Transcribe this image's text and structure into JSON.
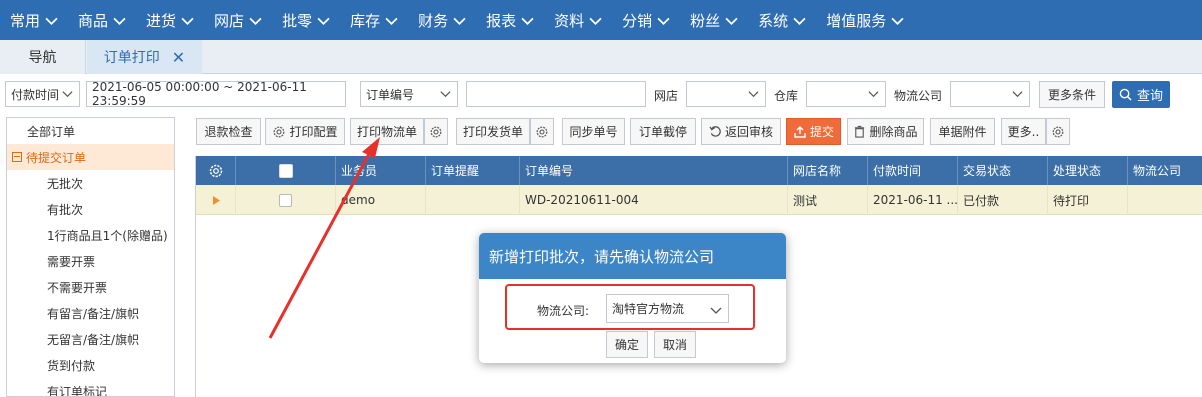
{
  "topnav": {
    "items": [
      {
        "label": "常用"
      },
      {
        "label": "商品"
      },
      {
        "label": "进货"
      },
      {
        "label": "网店"
      },
      {
        "label": "批零"
      },
      {
        "label": "库存"
      },
      {
        "label": "财务"
      },
      {
        "label": "报表"
      },
      {
        "label": "资料"
      },
      {
        "label": "分销"
      },
      {
        "label": "粉丝"
      },
      {
        "label": "系统"
      },
      {
        "label": "增值服务"
      }
    ]
  },
  "tabs": {
    "nav": "导航",
    "order_print": "订单打印",
    "close_glyph": "✕"
  },
  "filters": {
    "time_type": "付款时间",
    "date_range": "2021-06-05 00:00:00 ~ 2021-06-11 23:59:59",
    "order_field": "订单编号",
    "order_value": "",
    "shop_label": "网店",
    "shop_value": "",
    "warehouse_label": "仓库",
    "warehouse_value": "",
    "logistics_label": "物流公司",
    "logistics_value": "",
    "more_conditions": "更多条件",
    "query": "查询"
  },
  "sidebar": {
    "root": "全部订单",
    "group": "待提交订单",
    "children": [
      "无批次",
      "有批次",
      "1行商品且1个(除赠品)",
      "需要开票",
      "不需要开票",
      "有留言/备注/旗帜",
      "无留言/备注/旗帜",
      "货到付款",
      "有订单标记"
    ]
  },
  "toolbar": {
    "refund_check": "退款检查",
    "print_config": "打印配置",
    "print_logistics": "打印物流单",
    "print_invoice": "打印发货单",
    "sync_order": "同步单号",
    "intercept": "订单截停",
    "return_review": "返回审核",
    "submit": "提交",
    "delete_goods": "删除商品",
    "attachments": "单据附件",
    "more": "更多.."
  },
  "grid": {
    "headers": {
      "salesman": "业务员",
      "reminder": "订单提醒",
      "order_no": "订单编号",
      "shop_name": "网店名称",
      "pay_time": "付款时间",
      "trade_status": "交易状态",
      "process_status": "处理状态",
      "logistics": "物流公司"
    },
    "rows": [
      {
        "salesman": "demo",
        "reminder": "",
        "order_no": "WD-20210611-004",
        "shop_name": "测试",
        "pay_time": "2021-06-11 ...",
        "trade_status": "已付款",
        "process_status": "待打印",
        "logistics": ""
      }
    ]
  },
  "modal": {
    "title": "新增打印批次，请先确认物流公司",
    "logistics_label": "物流公司:",
    "logistics_value": "淘特官方物流",
    "confirm": "确定",
    "cancel": "取消"
  },
  "colors": {
    "nav_bg": "#2f6db3",
    "grid_header": "#3c6fa8",
    "modal_header": "#3c86c8",
    "submit_orange": "#f06b3a",
    "selected_group": "#e06a14",
    "annotation_red": "#e8302a"
  }
}
